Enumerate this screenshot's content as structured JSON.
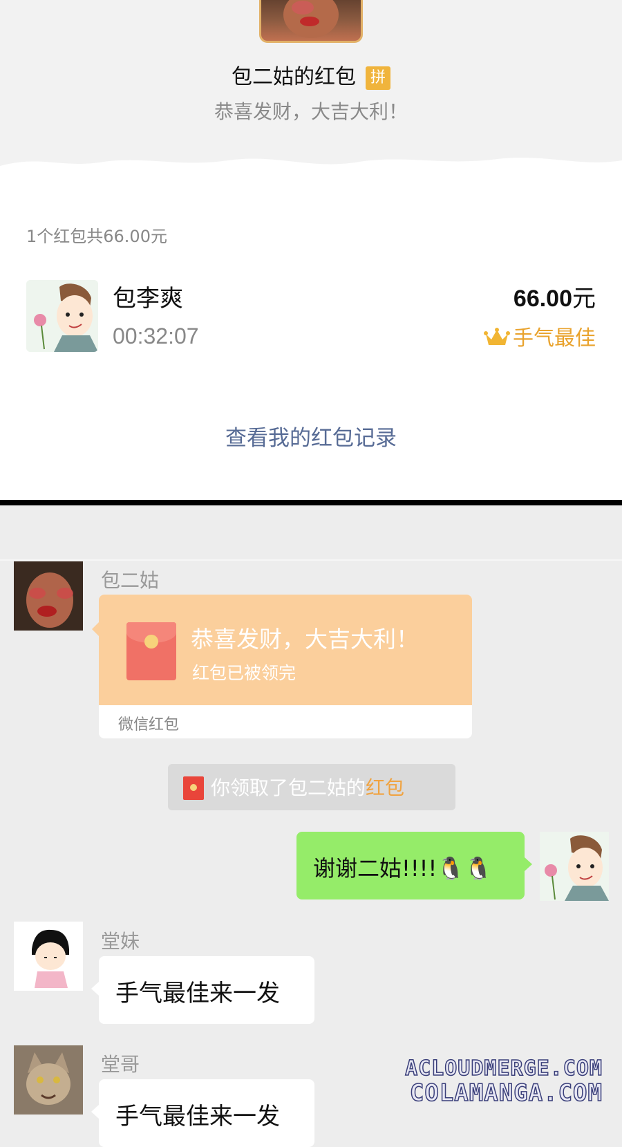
{
  "red_packet_detail": {
    "sender_title": "包二姑的红包",
    "pin_badge": "拼",
    "blessing": "恭喜发财，大吉大利！",
    "summary": "1个红包共66.00元",
    "receiver": {
      "name": "包李爽",
      "time": "00:32:07",
      "amount": "66.00",
      "amount_unit": "元",
      "best_luck_label": "手气最佳",
      "best_luck_icon": "crown-icon"
    },
    "view_records_link": "查看我的红包记录"
  },
  "chat": {
    "messages": [
      {
        "nickname": "包二姑",
        "type": "red_packet",
        "blessing": "恭喜发财，大吉大利！",
        "status": "红包已被领完",
        "footer": "微信红包"
      },
      {
        "type": "system",
        "text_prefix": "你领取了包二姑的",
        "text_highlight": "红包"
      },
      {
        "type": "text",
        "side": "right",
        "text": "谢谢二姑!!!!🐧🐧"
      },
      {
        "nickname": "堂妹",
        "type": "text",
        "text": "手气最佳来一发"
      },
      {
        "nickname": "堂哥",
        "type": "text",
        "text": "手气最佳来一发"
      }
    ]
  },
  "watermark": {
    "line1": "ACLOUDMERGE.COM",
    "line2": "COLAMANGA.COM"
  },
  "colors": {
    "link_blue": "#576b95",
    "best_luck_gold": "#e9a32e",
    "red_packet_card": "#fbcf9c",
    "self_bubble_green": "#95ec69",
    "notice_highlight": "#f0a341"
  }
}
